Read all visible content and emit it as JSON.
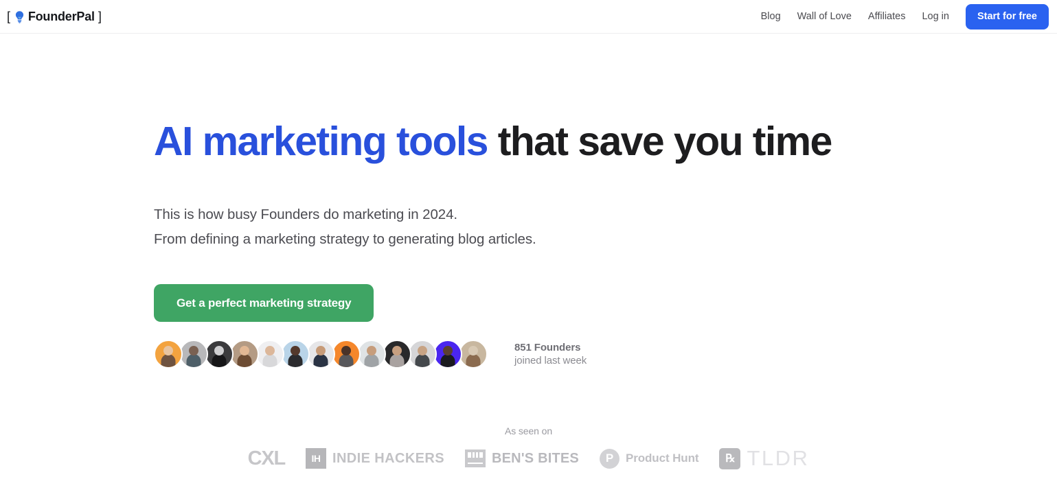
{
  "header": {
    "brand": {
      "open_bracket": "[",
      "icon": "lightbulb-icon",
      "name": "FounderPal",
      "close_bracket": "]"
    },
    "nav_links": [
      {
        "label": "Blog"
      },
      {
        "label": "Wall of Love"
      },
      {
        "label": "Affiliates"
      },
      {
        "label": "Log in"
      }
    ],
    "cta_label": "Start for free",
    "cta_color": "#2a62f0",
    "border_color": "#ededef"
  },
  "hero": {
    "headline_accent": "AI marketing tools",
    "headline_rest": " that save you time",
    "accent_color": "#2950dc",
    "headline_color": "#1d1d1f",
    "subhead_line1": "This is how busy Founders do marketing in 2024.",
    "subhead_line2": "From defining a marketing strategy to generating blog articles.",
    "cta_label": "Get a perfect marketing strategy",
    "cta_color": "#3fa564"
  },
  "social_proof": {
    "count_label": "851 Founders",
    "sub_label": "joined last week",
    "avatars": [
      {
        "bg": "#f3a33f",
        "face": "#6f5340",
        "head": "#e8c4a0"
      },
      {
        "bg": "#b8b8ba",
        "face": "#4e5f68",
        "head": "#7a6152"
      },
      {
        "bg": "#3b3b3d",
        "face": "#161618",
        "head": "#cfcfd1"
      },
      {
        "bg": "#b49b84",
        "face": "#6d4c33",
        "head": "#e2b894"
      },
      {
        "bg": "#efeff1",
        "face": "#d8d8da",
        "head": "#dcb79a"
      },
      {
        "bg": "#b9d4e8",
        "face": "#2b2b2e",
        "head": "#54392c"
      },
      {
        "bg": "#e6e6e8",
        "face": "#2a3344",
        "head": "#c79b78"
      },
      {
        "bg": "#f5872b",
        "face": "#58585b",
        "head": "#4a3328"
      },
      {
        "bg": "#dfe3e5",
        "face": "#9fa3a6",
        "head": "#c69d7c"
      },
      {
        "bg": "#29292b",
        "face": "#a9a2a0",
        "head": "#c79f80"
      },
      {
        "bg": "#d6d6d8",
        "face": "#44484c",
        "head": "#c7a384"
      },
      {
        "bg": "#4a26ef",
        "face": "#1b1b1f",
        "head": "#5c4030"
      },
      {
        "bg": "#c8b79f",
        "face": "#8b6b4f",
        "head": "#d8c9b4"
      }
    ]
  },
  "as_seen_on": {
    "label": "As seen on",
    "logos": [
      {
        "name": "cxl",
        "text": "CXL",
        "badge": ""
      },
      {
        "name": "indie-hackers",
        "text": "INDIE HACKERS",
        "badge": "IH"
      },
      {
        "name": "bens-bites",
        "text": "BEN'S BITES",
        "badge": ""
      },
      {
        "name": "product-hunt",
        "text": "Product Hunt",
        "badge": "P"
      },
      {
        "name": "tldr",
        "text": "TLDR",
        "badge": "℞"
      }
    ]
  }
}
